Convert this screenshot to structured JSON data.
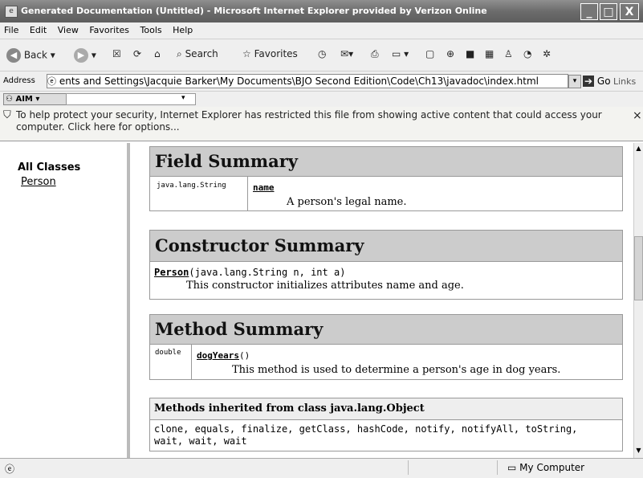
{
  "window": {
    "title": "Generated Documentation (Untitled) - Microsoft Internet Explorer provided by Verizon Online",
    "minimize": "_",
    "maximize": "□",
    "close": "X"
  },
  "menubar": [
    "File",
    "Edit",
    "View",
    "Favorites",
    "Tools",
    "Help"
  ],
  "toolbar": {
    "back_label": "Back",
    "search_label": "Search",
    "favorites_label": "Favorites"
  },
  "address": {
    "label": "Address",
    "value": "ents and Settings\\Jacquie Barker\\My Documents\\BJO Second Edition\\Code\\Ch13\\javadoc\\index.html",
    "go_label": "Go",
    "links_label": "Links"
  },
  "aim": {
    "label": "AIM"
  },
  "infobar": {
    "message": "To help protect your security, Internet Explorer has restricted this file from showing active content that could access your computer. Click here for options...",
    "close": "×"
  },
  "left_frame": {
    "heading": "All Classes",
    "classes": [
      "Person"
    ]
  },
  "field_summary": {
    "heading": "Field Summary",
    "type": "java.lang.String",
    "name": "name",
    "description": "A person's legal name."
  },
  "constructor_summary": {
    "heading": "Constructor Summary",
    "name": "Person",
    "signature": "(java.lang.String n, int a)",
    "description": "This constructor initializes attributes name and age."
  },
  "method_summary": {
    "heading": "Method Summary",
    "type": "double",
    "name": "dogYears",
    "signature": "()",
    "description": "This method is used to determine a person's age in dog years."
  },
  "inherited": {
    "heading": "Methods inherited from class java.lang.Object",
    "methods": "clone, equals, finalize, getClass, hashCode, notify, notifyAll, toString, wait, wait, wait"
  },
  "statusbar": {
    "zone": "My Computer"
  }
}
